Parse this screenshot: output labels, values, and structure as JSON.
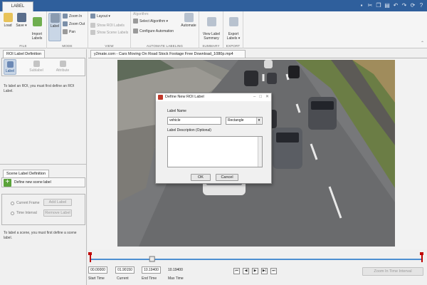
{
  "app": {
    "tab_label": "LABEL"
  },
  "toolstrip": {
    "file": {
      "group": "FILE",
      "load": "Load",
      "save": "Save",
      "import_labels": "Import\nLabels"
    },
    "mode": {
      "group": "MODE",
      "label": "Label",
      "zoom_in": "Zoom In",
      "zoom_out": "Zoom Out",
      "pan": "Pan"
    },
    "view": {
      "group": "VIEW",
      "layout": "Layout",
      "show_roi_labels": "Show ROI Labels",
      "show_scene_labels": "Show Scene Labels"
    },
    "automate": {
      "group": "AUTOMATE LABELING",
      "algorithm_header": "Algorithm:",
      "select_algorithm": "Select Algorithm",
      "configure": "Configure Automation",
      "automate": "Automate"
    },
    "summary": {
      "group": "SUMMARY",
      "view_label_summary": "View Label\nSummary"
    },
    "export": {
      "group": "EXPORT",
      "export_labels": "Export\nLabels"
    }
  },
  "roi_panel": {
    "tab": "ROI Label Definition",
    "buttons": {
      "label": "Label",
      "sublabel": "Sublabel",
      "attribute": "Attribute"
    },
    "hint": "To label an ROI, you must first define an ROI Label."
  },
  "scene_panel": {
    "tab": "Scene Label Definition",
    "define": "Define new scene label",
    "current_frame": "Current Frame",
    "time_interval": "Time Interval",
    "add_label": "Add Label",
    "remove_label": "Remove Label",
    "hint": "To label a scene, you must first define a scene label."
  },
  "video": {
    "tab_title": "y2mate.com - Cars Moving On Road Stock Footage  Free Download_1080p.mp4"
  },
  "dialog": {
    "title": "Define New ROI Label",
    "label_name_caption": "Label Name",
    "label_name_value": "vehicle",
    "shape": "Rectangle",
    "description_caption": "Label Description (Optional)",
    "ok": "OK",
    "cancel": "Cancel"
  },
  "timeline": {
    "start_time": "00.00000",
    "current": "01.90150",
    "end_time": "10.19400",
    "max_time": "10.19400",
    "start_caption": "Start Time",
    "current_caption": "Current",
    "end_caption": "End Time",
    "max_caption": "Max Time",
    "zoom_interval": "Zoom In Time Interval",
    "playhead_fraction": 0.186
  },
  "colors": {
    "accent": "#2f5f9c",
    "range_line": "#4d8fd1",
    "marker": "#c00000"
  }
}
